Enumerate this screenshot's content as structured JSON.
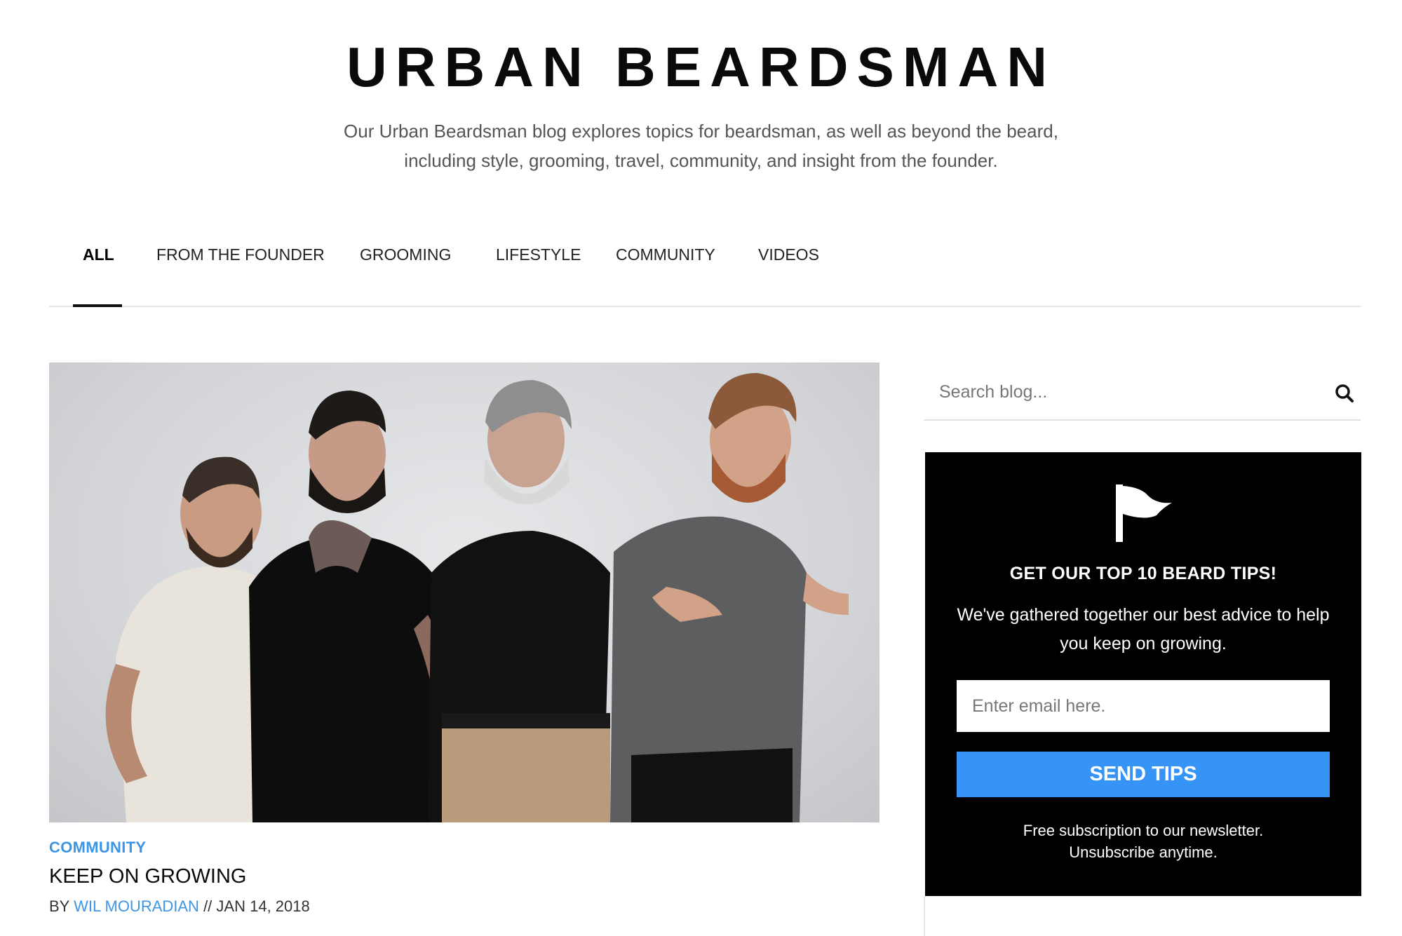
{
  "site": {
    "title": "URBAN BEARDSMAN",
    "tagline_line1": "Our Urban Beardsman blog explores topics for beardsman, as well as beyond the beard,",
    "tagline_line2": "including style, grooming, travel, community, and insight from the founder."
  },
  "nav": {
    "items": [
      {
        "label": "ALL",
        "active": true
      },
      {
        "label": "FROM THE FOUNDER",
        "active": false
      },
      {
        "label": "GROOMING",
        "active": false
      },
      {
        "label": "LIFESTYLE",
        "active": false
      },
      {
        "label": "COMMUNITY",
        "active": false
      },
      {
        "label": "VIDEOS",
        "active": false
      }
    ]
  },
  "post": {
    "category": "COMMUNITY",
    "title": "KEEP ON GROWING",
    "by_prefix": "BY",
    "author": "WIL MOURADIAN",
    "date_separator": "//",
    "date": "JAN 14, 2018",
    "image_icon": "photo-four-bearded-men"
  },
  "search": {
    "placeholder": "Search blog...",
    "icon": "search-icon"
  },
  "promo": {
    "icon": "flag-icon",
    "heading": "GET OUR TOP 10 BEARD TIPS!",
    "description": "We've gathered together our best advice to help you keep on growing.",
    "email_placeholder": "Enter email here.",
    "button_label": "SEND TIPS",
    "fine_line1": "Free subscription to our newsletter.",
    "fine_line2": "Unsubscribe anytime."
  },
  "colors": {
    "accent": "#3d95e6",
    "button": "#3794f7",
    "promo_bg": "#000000"
  }
}
